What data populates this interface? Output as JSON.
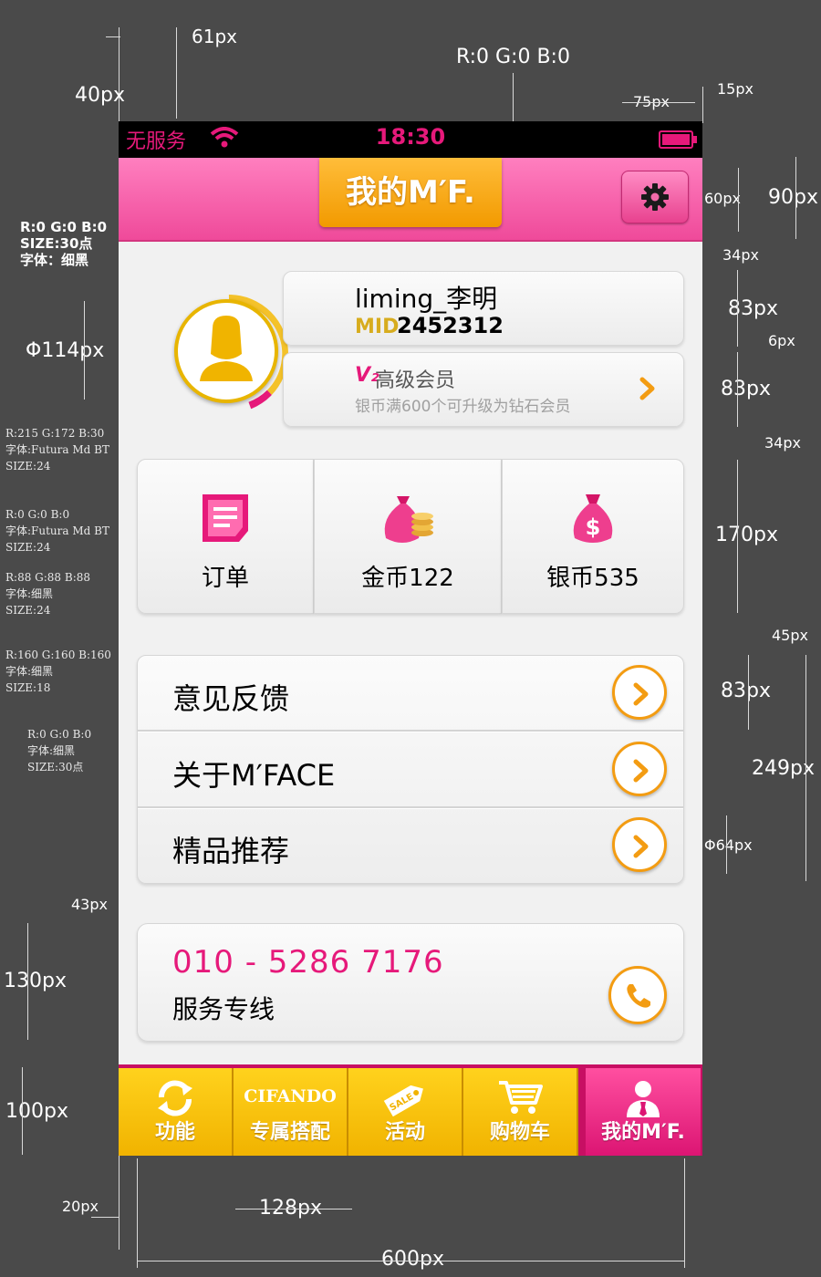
{
  "annotations": {
    "px40": "40px",
    "px61": "61px",
    "rgb_top": "R:0 G:0 B:0",
    "px75": "75px",
    "px15": "15px",
    "px60": "60px",
    "px90": "90px",
    "px34a": "34px",
    "px83a": "83px",
    "px6": "6px",
    "px83b": "83px",
    "px34b": "34px",
    "px170": "170px",
    "px45": "45px",
    "px83c": "83px",
    "px249": "249px",
    "phi64": "Φ64px",
    "phi114": "Φ114px",
    "px43": "43px",
    "px130": "130px",
    "px100": "100px",
    "px20": "20px",
    "px128": "128px",
    "px600": "600px",
    "spec_title": "R:0 G:0 B:0\nSIZE:30点\n字体：细黑",
    "spec_mid": "R:215 G:172 B:30\n字体:Futura Md BT\nSIZE:24",
    "spec_num": "R:0 G:0 B:0\n字体:Futura Md BT\nSIZE:24",
    "spec_level": "R:88 G:88 B:88\n字体:细黑\nSIZE:24",
    "spec_hint": "R:160 G:160 B:160\n字体:细黑\nSIZE:18",
    "spec_menu": "R:0 G:0 B:0\n字体:细黑\nSIZE:30点"
  },
  "status_bar": {
    "carrier": "无服务",
    "time": "18:30"
  },
  "nav": {
    "title": "我的M′F.",
    "settings_icon": "gear-icon"
  },
  "profile": {
    "username": "liming_李明",
    "mid_label": "MID",
    "mid_value": "2452312",
    "level_badge": "V₂",
    "level_name": "高级会员",
    "level_hint": "银币满600个可升级为钻石会员"
  },
  "stats": [
    {
      "label": "订单",
      "icon": "order-icon"
    },
    {
      "label": "金币122",
      "icon": "gold-coin-bag-icon"
    },
    {
      "label": "银币535",
      "icon": "money-bag-icon"
    }
  ],
  "menu": [
    {
      "label": "意见反馈"
    },
    {
      "label": "关于M′FACE"
    },
    {
      "label": "精品推荐"
    }
  ],
  "contact": {
    "phone": "010 - 5286 7176",
    "label": "服务专线"
  },
  "tabbar": [
    {
      "label": "功能",
      "icon": "refresh-icon"
    },
    {
      "label": "专属搭配",
      "brand": "CIFANDO"
    },
    {
      "label": "活动",
      "icon": "sale-tag-icon"
    },
    {
      "label": "购物车",
      "icon": "cart-icon"
    },
    {
      "label": "我的M′F.",
      "icon": "user-icon",
      "active": true
    }
  ],
  "colors": {
    "pink": "#e6197a",
    "orange": "#f39c12",
    "gold": "#d7ac1e",
    "yellow": "#ffd21d"
  }
}
